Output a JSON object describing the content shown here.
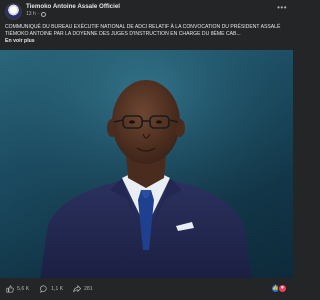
{
  "post": {
    "author": "Tiemoko Antoine Assale Officiel",
    "time": "13 h",
    "visibility_icon": "globe-icon",
    "caption": "COMMUNIQUÉ DU BUREAU EXÉCUTIF NATIONAL DE ADCI RELATIF À LA CONVOCATION DU PRÉSIDENT ASSALÉ TIÉMOKO ANTOINE PAR LA DOYENNE DES JUGES D'INSTRUCTION EN CHARGE DU 8ÈME CAB...",
    "see_more": "En voir plus"
  },
  "reactions": {
    "likes": "5,6 K",
    "comments": "1,1 K",
    "shares": "281",
    "icons": [
      "like-icon",
      "love-icon"
    ]
  },
  "colors": {
    "background": "#242526",
    "text": "#e4e6eb",
    "secondary": "#b0b3b8",
    "like_blue": "#1877f2",
    "love_red": "#f33e58"
  }
}
